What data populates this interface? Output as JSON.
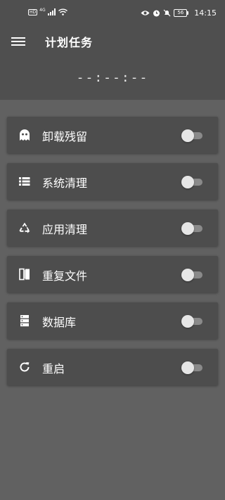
{
  "status_bar": {
    "left_badge": "HD",
    "signal_label": "4G",
    "battery": "56",
    "time": "14:15"
  },
  "app_bar": {
    "title": "计划任务",
    "clock": "--:--:--"
  },
  "tasks": [
    {
      "label": "卸载残留",
      "icon": "ghost-icon",
      "enabled": false
    },
    {
      "label": "系统清理",
      "icon": "list-icon",
      "enabled": false
    },
    {
      "label": "应用清理",
      "icon": "recycle-icon",
      "enabled": false
    },
    {
      "label": "重复文件",
      "icon": "duplicate-file-icon",
      "enabled": false
    },
    {
      "label": "数据库",
      "icon": "database-icon",
      "enabled": false
    },
    {
      "label": "重启",
      "icon": "refresh-icon",
      "enabled": false
    }
  ]
}
